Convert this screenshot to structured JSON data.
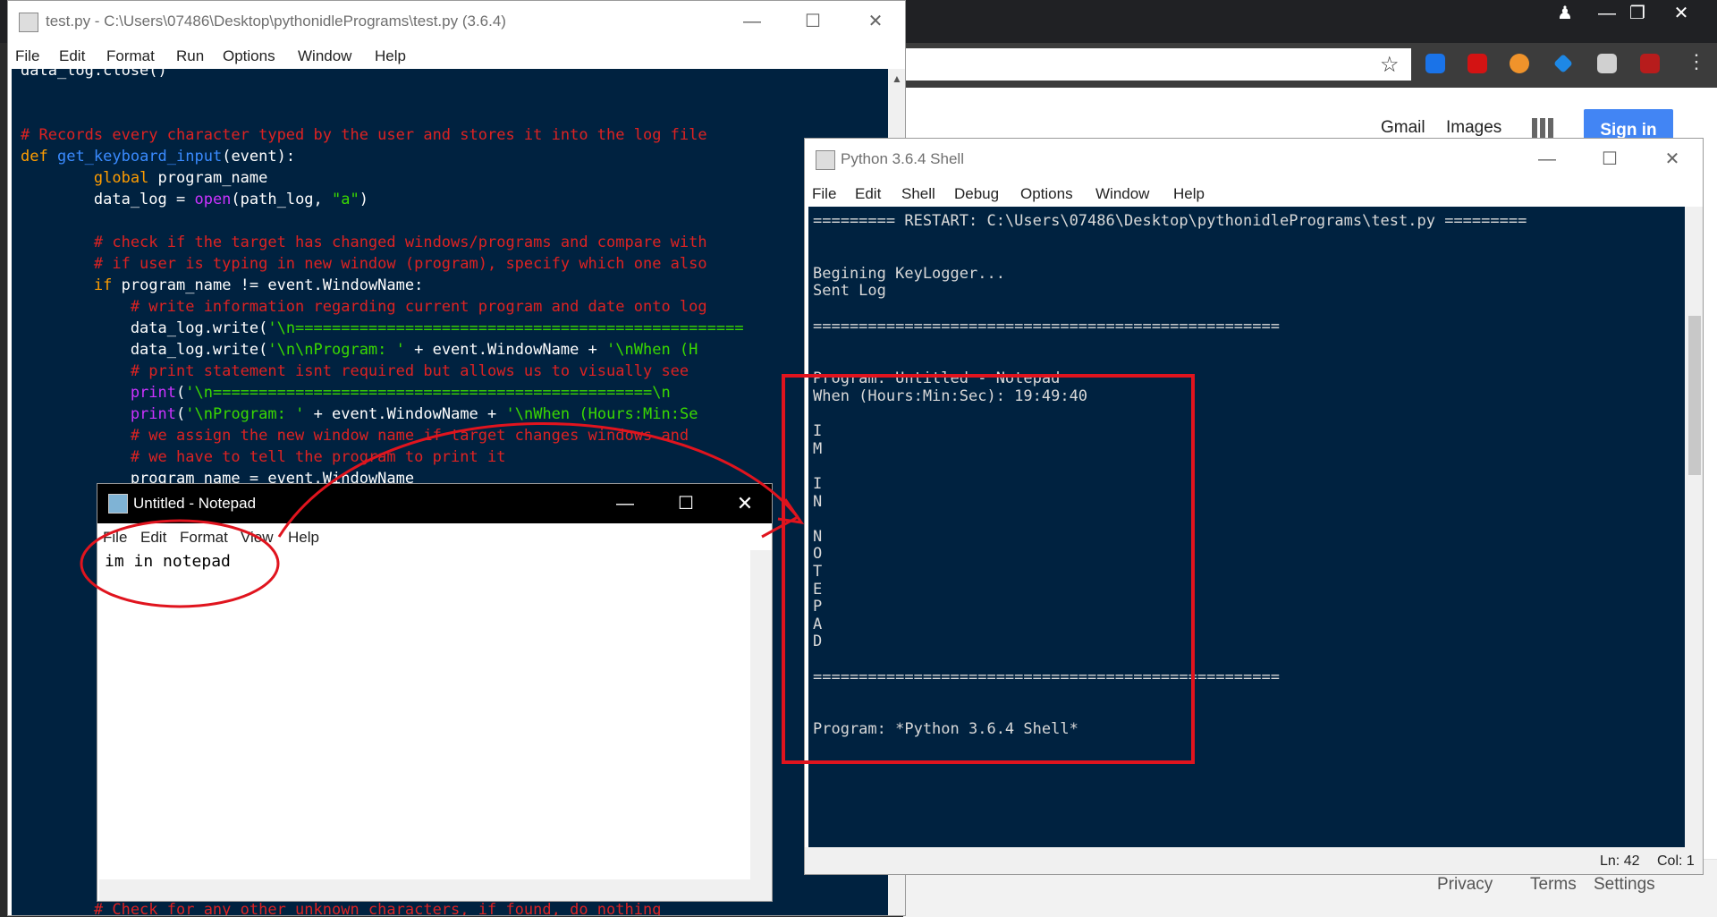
{
  "chrome": {
    "links": [
      "Gmail",
      "Images"
    ],
    "sign_in": "Sign in",
    "footer": [
      "Privacy",
      "Terms",
      "Settings"
    ]
  },
  "editor": {
    "title": "test.py - C:\\Users\\07486\\Desktop\\pythonidlePrograms\\test.py (3.6.4)",
    "menu": [
      "File",
      "Edit",
      "Format",
      "Run",
      "Options",
      "Window",
      "Help"
    ]
  },
  "shell": {
    "title": "Python 3.6.4 Shell",
    "menu": [
      "File",
      "Edit",
      "Shell",
      "Debug",
      "Options",
      "Window",
      "Help"
    ],
    "lines": [
      "========= RESTART: C:\\Users\\07486\\Desktop\\pythonidlePrograms\\test.py =========",
      "",
      "",
      "Begining KeyLogger...",
      "Sent Log",
      "",
      "===================================================",
      "",
      "",
      "Program: Untitled - Notepad",
      "When (Hours:Min:Sec): 19:49:40",
      "",
      "I",
      "M",
      "",
      "I",
      "N",
      "",
      "N",
      "O",
      "T",
      "E",
      "P",
      "A",
      "D",
      "",
      "===================================================",
      "",
      "",
      "Program: *Python 3.6.4 Shell*"
    ],
    "status_ln": "Ln: 42",
    "status_col": "Col: 1"
  },
  "notepad": {
    "title": "Untitled - Notepad",
    "menu": [
      "File",
      "Edit",
      "Format",
      "View",
      "Help"
    ],
    "content": "im in notepad"
  }
}
